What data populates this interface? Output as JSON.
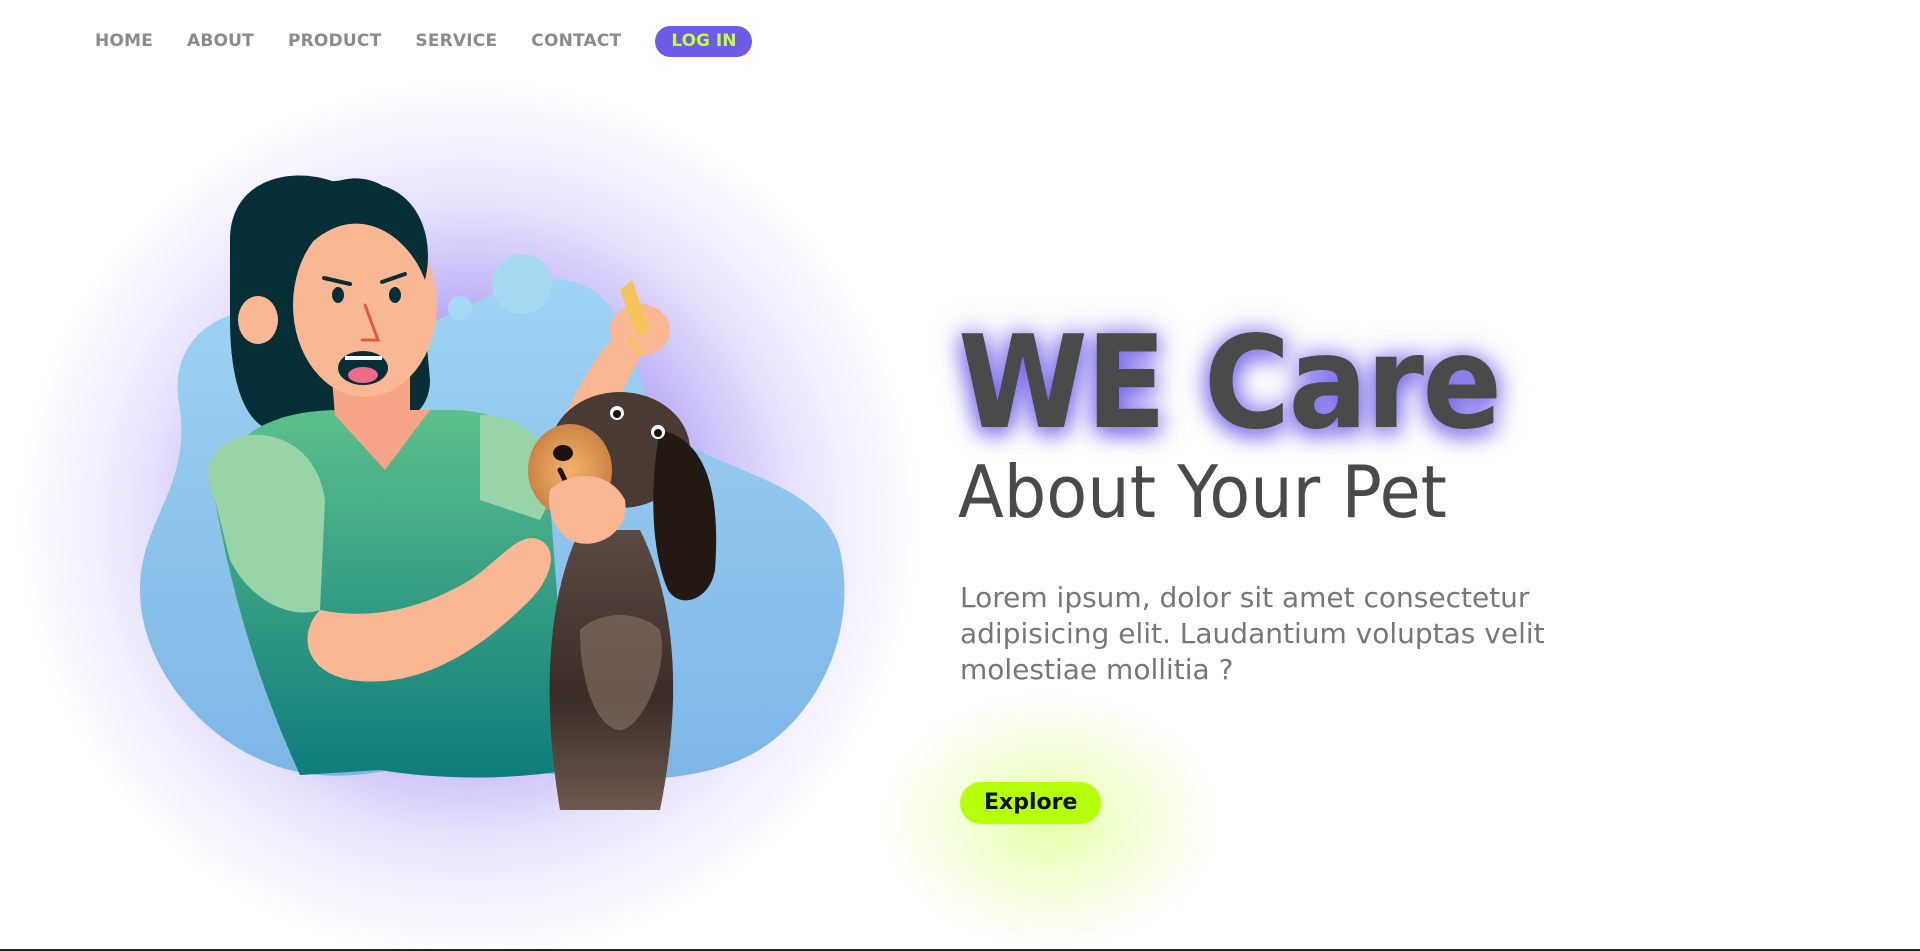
{
  "nav": {
    "items": [
      {
        "label": "HOME"
      },
      {
        "label": "ABOUT"
      },
      {
        "label": "PRODUCT"
      },
      {
        "label": "SERVICE"
      },
      {
        "label": "CONTACT"
      }
    ],
    "login_label": "LOG IN"
  },
  "hero": {
    "title": "WE Care",
    "subtitle": "About Your Pet",
    "description": "Lorem ipsum, dolor sit amet consectetur adipisicing elit. Laudantium voluptas velit molestiae mollitia ?",
    "cta_label": "Explore"
  },
  "illustration": {
    "icon": "woman-giving-dog-eye-drops-illustration"
  },
  "colors": {
    "accent_purple": "#6c5ce7",
    "accent_lime": "#b6ff0a",
    "login_text": "#c5ff3a",
    "heading": "#4a4a4a",
    "body_text": "#777777",
    "nav_text": "#8b8b8b",
    "blob_blue": "#8ec9ef"
  }
}
